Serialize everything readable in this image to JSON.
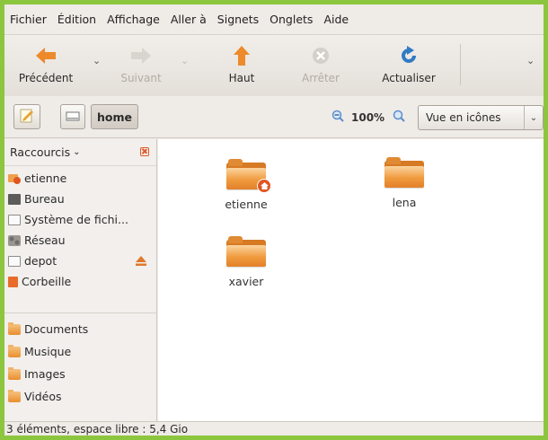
{
  "menubar": {
    "items": [
      "Fichier",
      "Édition",
      "Affichage",
      "Aller à",
      "Signets",
      "Onglets",
      "Aide"
    ]
  },
  "toolbar": {
    "back_label": "Précédent",
    "forward_label": "Suivant",
    "up_label": "Haut",
    "stop_label": "Arrêter",
    "reload_label": "Actualiser"
  },
  "location": {
    "crumb": "home",
    "zoom": "100%",
    "view_mode": "Vue en icônes"
  },
  "sidebar": {
    "title": "Raccourcis",
    "items": [
      {
        "label": "etienne",
        "icon": "home-icon"
      },
      {
        "label": "Bureau",
        "icon": "desktop-icon"
      },
      {
        "label": "Système de fichi...",
        "icon": "drive-icon"
      },
      {
        "label": "Réseau",
        "icon": "network-icon"
      },
      {
        "label": "depot",
        "icon": "drive-icon"
      },
      {
        "label": "Corbeille",
        "icon": "trash-icon"
      },
      {
        "label": "Documents",
        "icon": "folder-icon"
      },
      {
        "label": "Musique",
        "icon": "folder-icon"
      },
      {
        "label": "Images",
        "icon": "folder-icon"
      },
      {
        "label": "Vidéos",
        "icon": "folder-icon"
      }
    ]
  },
  "files": [
    {
      "name": "etienne",
      "home": true
    },
    {
      "name": "lena",
      "home": false
    },
    {
      "name": "xavier",
      "home": false
    }
  ],
  "status": {
    "text": "3 éléments, espace libre : 5,4 Gio"
  },
  "colors": {
    "frame": "#8cc63f",
    "accent": "#e0582a",
    "folder": "#f09b3e"
  }
}
